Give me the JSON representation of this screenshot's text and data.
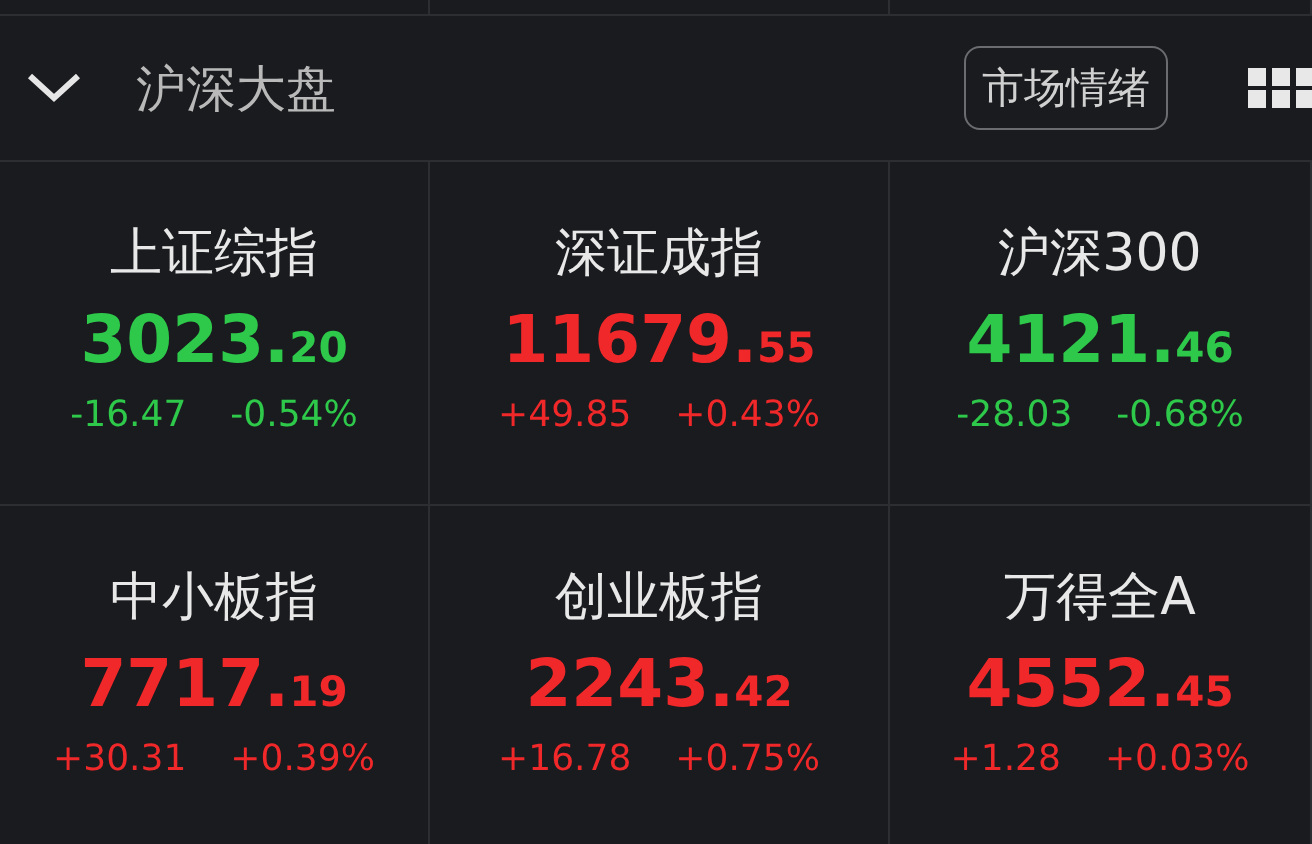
{
  "header": {
    "title": "沪深大盘",
    "expanded": true,
    "button": "市场情绪"
  },
  "indices": [
    {
      "name": "上证综指",
      "integer": "3023.",
      "decimals": "20",
      "change": "-16.47",
      "percent": "-0.54%",
      "color": "#2ec94a"
    },
    {
      "name": "深证成指",
      "integer": "11679.",
      "decimals": "55",
      "change": "+49.85",
      "percent": "+0.43%",
      "color": "#f0282a"
    },
    {
      "name": "沪深300",
      "integer": "4121.",
      "decimals": "46",
      "change": "-28.03",
      "percent": "-0.68%",
      "color": "#2ec94a"
    },
    {
      "name": "中小板指",
      "integer": "7717.",
      "decimals": "19",
      "change": "+30.31",
      "percent": "+0.39%",
      "color": "#f0282a"
    },
    {
      "name": "创业板指",
      "integer": "2243.",
      "decimals": "42",
      "change": "+16.78",
      "percent": "+0.75%",
      "color": "#f0282a"
    },
    {
      "name": "万得全A",
      "integer": "4552.",
      "decimals": "45",
      "change": "+1.28",
      "percent": "+0.03%",
      "color": "#f0282a"
    }
  ]
}
